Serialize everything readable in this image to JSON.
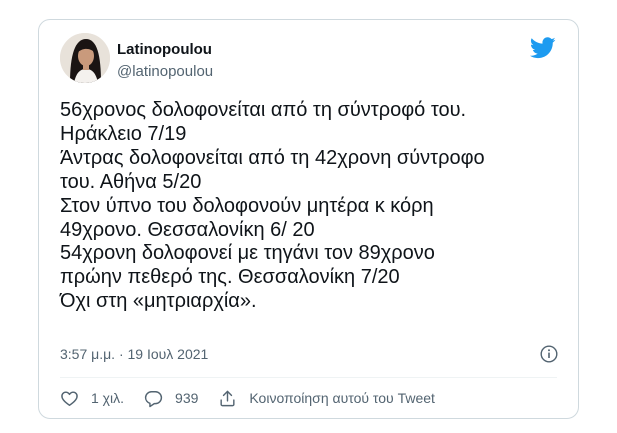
{
  "tweet": {
    "author_name": "Latinopoulou",
    "author_handle": "@latinopoulou",
    "lines": [
      "56χρονος δολοφονείται από τη σύντροφό του.",
      "Ηράκλειο 7/19",
      "Άντρας δολοφονείται από τη 42χρονη σύντροφο",
      "του. Αθήνα 5/20",
      "Στον ύπνο του δολοφονούν μητέρα κ κόρη",
      "49χρονο. Θεσσαλονίκη 6/ 20",
      "54χρονη δολοφονεί με τηγάνι τον 89χρονο",
      "πρώην πεθερό της. Θεσσαλονίκη  7/20",
      "Όχι στη «μητριαρχία»."
    ],
    "timestamp": "3:57 μ.μ. · 19 Ιουλ 2021",
    "likes": "1 χιλ.",
    "replies": "939",
    "share_label": "Κοινοποίηση αυτού του Tweet"
  },
  "icons": {
    "brand": "twitter-bird-icon",
    "info": "info-icon",
    "like": "heart-icon",
    "reply": "reply-bubble-icon",
    "share": "share-upload-icon"
  },
  "colors": {
    "brand_blue": "#1d9bf0",
    "text": "#0f1419",
    "muted": "#536471",
    "border": "#cfd9de"
  }
}
